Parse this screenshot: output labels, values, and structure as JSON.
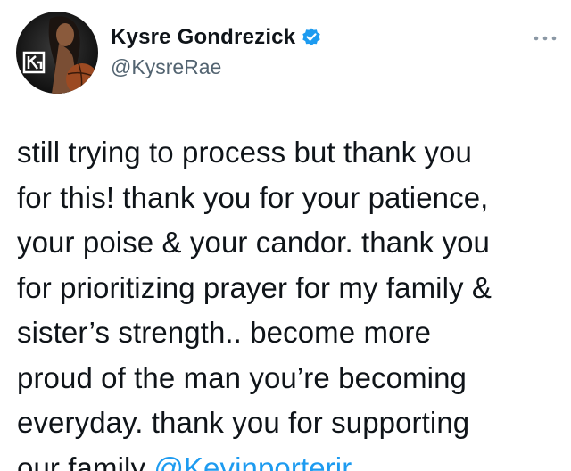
{
  "author": {
    "display_name": "Kysre Gondrezick",
    "handle": "@KysreRae",
    "verified": true,
    "avatar_logo_text": "KG"
  },
  "tweet": {
    "text": "still trying to process but thank you\nfor this! thank you for your patience,\nyour poise & your candor. thank you\nfor prioritizing prayer for my family &\nsister’s strength.. become more\nproud of the man you’re becoming\neveryday. thank you for supporting\nour family ",
    "mention": "@Kevinporterjr"
  },
  "colors": {
    "text": "#0f1419",
    "secondary": "#536471",
    "accent": "#1d9bf0"
  },
  "icons": {
    "verified": "verified-badge-icon",
    "more": "more-options-icon"
  }
}
